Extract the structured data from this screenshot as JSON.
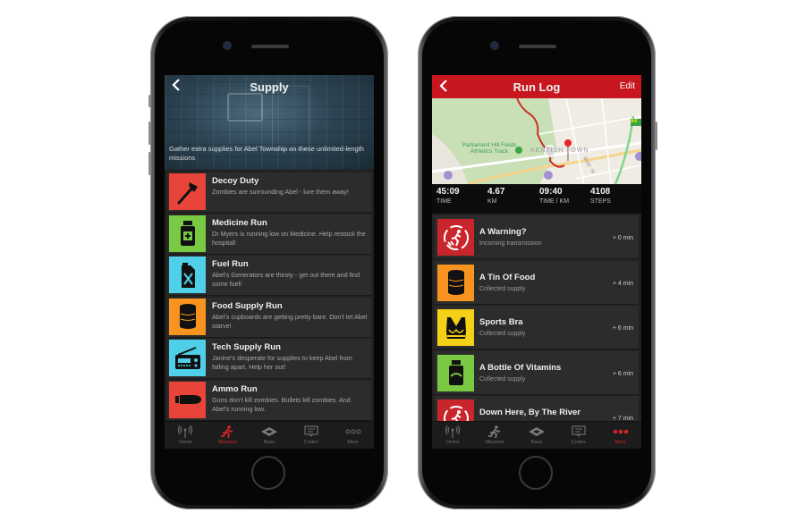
{
  "left_phone": {
    "header": {
      "title": "Supply",
      "back_icon": "chevron-left-icon"
    },
    "description": "Gather extra supplies for Abel Township on these unlimited-length missions",
    "missions": [
      {
        "title": "Decoy Duty",
        "desc": "Zombies are surrounding Abel - lure them away!",
        "icon": "axe-icon",
        "color": "#e8443a"
      },
      {
        "title": "Medicine Run",
        "desc": "Dr Myers is running low on Medicine. Help restock the hospital!",
        "icon": "medicine-bottle-icon",
        "color": "#7ac943"
      },
      {
        "title": "Fuel Run",
        "desc": "Abel's Generators are thirsty - get out there and find some fuel!",
        "icon": "jerry-can-icon",
        "color": "#4fd0e8"
      },
      {
        "title": "Food Supply Run",
        "desc": "Abel's cupboards are getting pretty bare. Don't let Abel starve!",
        "icon": "tin-can-icon",
        "color": "#f7931e"
      },
      {
        "title": "Tech Supply Run",
        "desc": "Janine's desperate for supplies to keep Abel from falling apart. Help her out!",
        "icon": "radio-icon",
        "color": "#4fd0e8"
      },
      {
        "title": "Ammo Run",
        "desc": "Guns don't kill zombies. Bullets kill zombies. And Abel's running low.",
        "icon": "bullet-icon",
        "color": "#e8443a"
      }
    ],
    "tabs": [
      {
        "label": "Home",
        "icon": "antenna-icon",
        "active": false
      },
      {
        "label": "Missions",
        "icon": "runner-icon",
        "active": true
      },
      {
        "label": "Base",
        "icon": "base-icon",
        "active": false
      },
      {
        "label": "Codex",
        "icon": "codex-icon",
        "active": false
      },
      {
        "label": "More",
        "icon": "more-dots-icon",
        "active": false
      }
    ]
  },
  "right_phone": {
    "header": {
      "title": "Run Log",
      "edit_label": "Edit",
      "back_icon": "chevron-left-icon"
    },
    "map": {
      "park_label": "Parliament Hill Fields Athletics Track",
      "area_label": "KENTISH TOWN",
      "road_label": "B518 - M",
      "road_badge": "A4",
      "route_color": "#c9302c"
    },
    "stats": [
      {
        "value": "45:09",
        "label": "TIME"
      },
      {
        "value": "4.67",
        "label": "KM"
      },
      {
        "value": "09:40",
        "label": "TIME / KM"
      },
      {
        "value": "4108",
        "label": "STEPS"
      }
    ],
    "log": [
      {
        "title": "A Warning?",
        "sub": "Incoming transmission",
        "time": "+ 0 min",
        "icon": "transmission-icon",
        "color": "#c9252c"
      },
      {
        "title": "A Tin Of Food",
        "sub": "Collected supply",
        "time": "+ 4 min",
        "icon": "tin-can-icon",
        "color": "#f7931e"
      },
      {
        "title": "Sports Bra",
        "sub": "Collected supply",
        "time": "+ 6 min",
        "icon": "sports-bra-icon",
        "color": "#f5d018"
      },
      {
        "title": "A Bottle Of Vitamins",
        "sub": "Collected supply",
        "time": "+ 6 min",
        "icon": "vitamins-bottle-icon",
        "color": "#7ac943"
      },
      {
        "title": "Down Here, By The River",
        "sub": "",
        "time": "+ 7 min",
        "icon": "transmission-icon",
        "color": "#c9252c"
      }
    ],
    "tabs": [
      {
        "label": "Home",
        "icon": "antenna-icon",
        "active": false
      },
      {
        "label": "Missions",
        "icon": "runner-icon",
        "active": false
      },
      {
        "label": "Base",
        "icon": "base-icon",
        "active": false
      },
      {
        "label": "Codex",
        "icon": "codex-icon",
        "active": false
      },
      {
        "label": "More",
        "icon": "more-dots-icon",
        "active": true
      }
    ]
  }
}
